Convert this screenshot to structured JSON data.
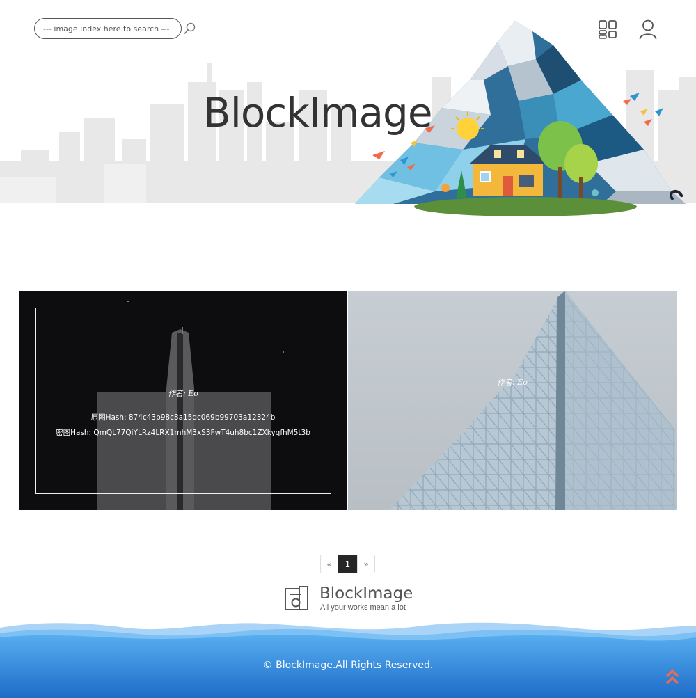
{
  "search": {
    "placeholder": "--- image index here to search ---"
  },
  "header": {
    "title": "BlockImage"
  },
  "gallery": [
    {
      "author": "作者: Eo",
      "origin_hash": "原图Hash: 874c43b98c8a15dc069b99703a12324b",
      "cipher_hash": "密图Hash: QmQL77QiYLRz4LRX1mhM3xS3FwT4uh8bc1ZXkyqfhM5t3b"
    },
    {
      "author": "作者: Eo"
    }
  ],
  "pagination": {
    "prev": "«",
    "current": "1",
    "next": "»"
  },
  "footer": {
    "logo_name": "BlockImage",
    "logo_tagline": "All your works mean a lot",
    "copyright": "© BlockImage.All Rights Reserved."
  },
  "icons": {
    "search": "magnifier-icon",
    "gallery": "grid-icon",
    "user": "user-icon",
    "back_to_top": "double-chevron-up-icon"
  },
  "colors": {
    "footer_blue": "#2f7fd6",
    "accent_orange": "#f26a4b"
  }
}
